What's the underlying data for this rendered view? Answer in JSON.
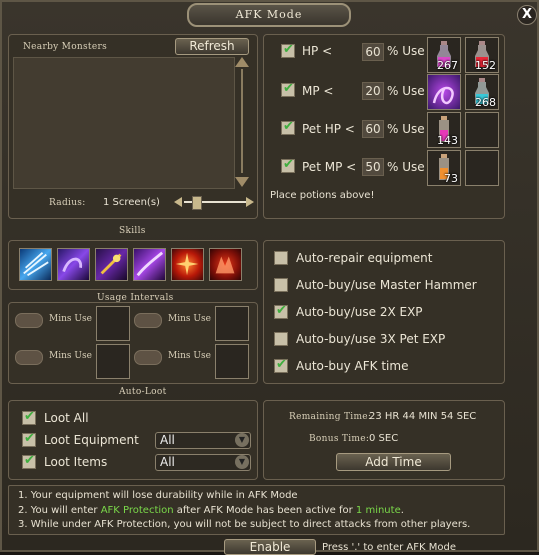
{
  "window": {
    "title": "AFK Mode",
    "close_glyph": "X"
  },
  "monsters": {
    "title": "Nearby Monsters",
    "refresh_label": "Refresh",
    "radius_label": "Radius:",
    "radius_value": "1 Screen(s)"
  },
  "potions": {
    "rows": [
      {
        "label": "HP <",
        "value": "60",
        "unit": "% Use",
        "checked": true,
        "slot1_count": "267",
        "slot2_count": "152"
      },
      {
        "label": "MP <",
        "value": "20",
        "unit": "% Use",
        "checked": true,
        "slot1_count": "",
        "slot2_count": "268"
      },
      {
        "label": "Pet HP <",
        "value": "60",
        "unit": "% Use",
        "checked": true,
        "slot1_count": "143",
        "slot2_count": ""
      },
      {
        "label": "Pet MP <",
        "value": "50",
        "unit": "% Use",
        "checked": true,
        "slot1_count": "73",
        "slot2_count": ""
      }
    ],
    "hint": "Place potions above!"
  },
  "skills": {
    "title": "Skills",
    "icons": [
      "ice-shard-skill-icon",
      "purple-dragon-skill-icon",
      "gold-strike-skill-icon",
      "violet-arc-skill-icon",
      "fire-burst-skill-icon",
      "red-demon-skill-icon"
    ]
  },
  "intervals": {
    "title": "Usage Intervals",
    "mins_label": "Mins Use"
  },
  "auto": {
    "items": [
      {
        "label": "Auto-repair equipment",
        "checked": false
      },
      {
        "label": "Auto-buy/use Master Hammer",
        "checked": false
      },
      {
        "label": "Auto-buy/use 2X EXP",
        "checked": true
      },
      {
        "label": "Auto-buy/use 3X Pet EXP",
        "checked": false
      },
      {
        "label": "Auto-buy AFK time",
        "checked": true
      }
    ]
  },
  "autoloot": {
    "title": "Auto-Loot",
    "loot_all": "Loot All",
    "loot_equipment": "Loot Equipment",
    "loot_items": "Loot Items",
    "equipment_select": "All",
    "items_select": "All"
  },
  "time": {
    "remaining_label": "Remaining Time:",
    "remaining_value": "23 HR 44 MIN 54 SEC",
    "bonus_label": "Bonus Time:",
    "bonus_value": "0 SEC",
    "add_label": "Add Time"
  },
  "notes": {
    "line1": "1. Your equipment will lose durability while in AFK Mode",
    "line2_a": "2. You will enter ",
    "line2_b": "AFK Protection",
    "line2_c": " after AFK Mode has been active for ",
    "line2_d": "1 minute",
    "line2_e": ".",
    "line3": "3. While under AFK Protection, you will not be subject to direct attacks from other players."
  },
  "footer": {
    "enable_label": "Enable",
    "hint": "Press '.' to enter AFK Mode"
  }
}
